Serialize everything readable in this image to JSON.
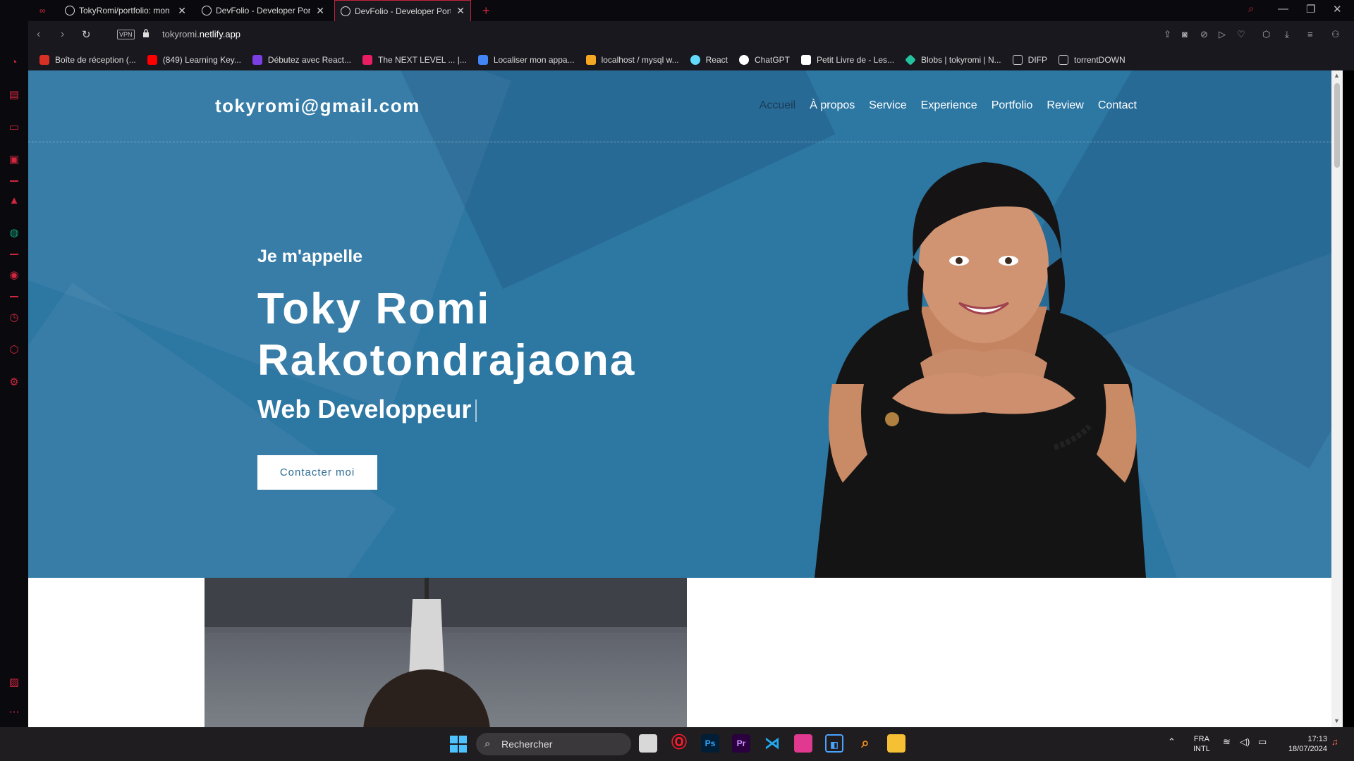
{
  "tabs": [
    {
      "title": "TokyRomi/portfolio: mon p"
    },
    {
      "title": "DevFolio - Developer Portfo"
    },
    {
      "title": "DevFolio - Developer Portfo"
    }
  ],
  "address": {
    "host_prefix": "tokyromi.",
    "host_main": "netlify.app",
    "vpn_label": "VPN"
  },
  "bookmarks": [
    {
      "label": "Boîte de réception (...",
      "color": "#d93025"
    },
    {
      "label": "(849) Learning Key...",
      "color": "#ff0000"
    },
    {
      "label": "Débutez avec React...",
      "color": "#7b3fe4"
    },
    {
      "label": "The NEXT LEVEL ... |...",
      "color": "#e91e63"
    },
    {
      "label": "Localiser mon appa...",
      "color": "#4285f4"
    },
    {
      "label": "localhost / mysql w...",
      "color": "#f5a623"
    },
    {
      "label": "React",
      "color": "#61dafb"
    },
    {
      "label": "ChatGPT",
      "color": "#ffffff"
    },
    {
      "label": "Petit Livre de - Les...",
      "color": "#ffffff"
    },
    {
      "label": "Blobs | tokyromi | N...",
      "color": "#25c2a0"
    },
    {
      "label": "DIFP",
      "color": "#cccccc"
    },
    {
      "label": "torrentDOWN",
      "color": "#cccccc"
    }
  ],
  "site": {
    "logo": "tokyromi@gmail.com",
    "menu": [
      "Accueil",
      "À propos",
      "Service",
      "Experience",
      "Portfolio",
      "Review",
      "Contact"
    ],
    "intro": "Je m'appelle",
    "name_line1": "Toky Romi",
    "name_line2": "Rakotondrajaona",
    "role": "Web Developpeur",
    "cta": "Contacter moi"
  },
  "taskbar": {
    "search_placeholder": "Rechercher",
    "lang_top": "FRA",
    "lang_bottom": "INTL",
    "time": "17:13",
    "date": "18/07/2024",
    "apps": [
      "Ps",
      "Pr"
    ]
  },
  "colors": {
    "hero_bg": "#2d77a3",
    "accent_red": "#d0263f",
    "active_menu": "#1b3b55"
  }
}
